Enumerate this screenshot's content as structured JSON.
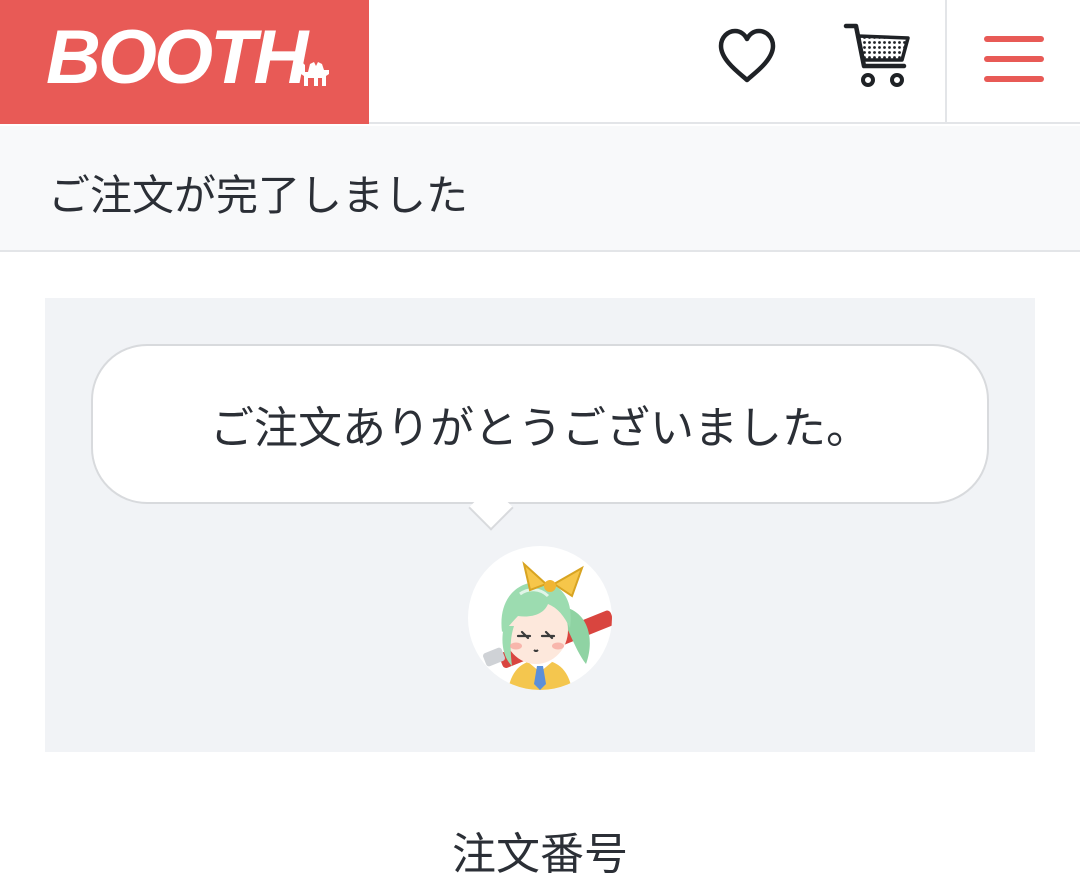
{
  "header": {
    "logo_text": "BOOTH",
    "icons": [
      "camel-icon",
      "heart-icon",
      "cart-icon",
      "hamburger-menu-icon"
    ],
    "accent_color": "#e85a56"
  },
  "subheader": {
    "title": "ご注文が完了しました"
  },
  "panel": {
    "message": "ご注文ありがとうございました。"
  },
  "order": {
    "label": "注文番号"
  }
}
